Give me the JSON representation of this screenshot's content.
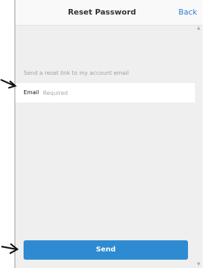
{
  "header": {
    "title": "Reset Password",
    "back_label": "Back"
  },
  "form": {
    "hint": "Send a reset link to my account email",
    "email_label": "Email",
    "email_placeholder": "Required",
    "email_value": ""
  },
  "actions": {
    "send_label": "Send"
  },
  "colors": {
    "accent": "#2f8bd1",
    "background": "#efefef"
  },
  "icons": [
    "arrow-right-icon",
    "scroll-up-icon",
    "scroll-down-icon"
  ]
}
